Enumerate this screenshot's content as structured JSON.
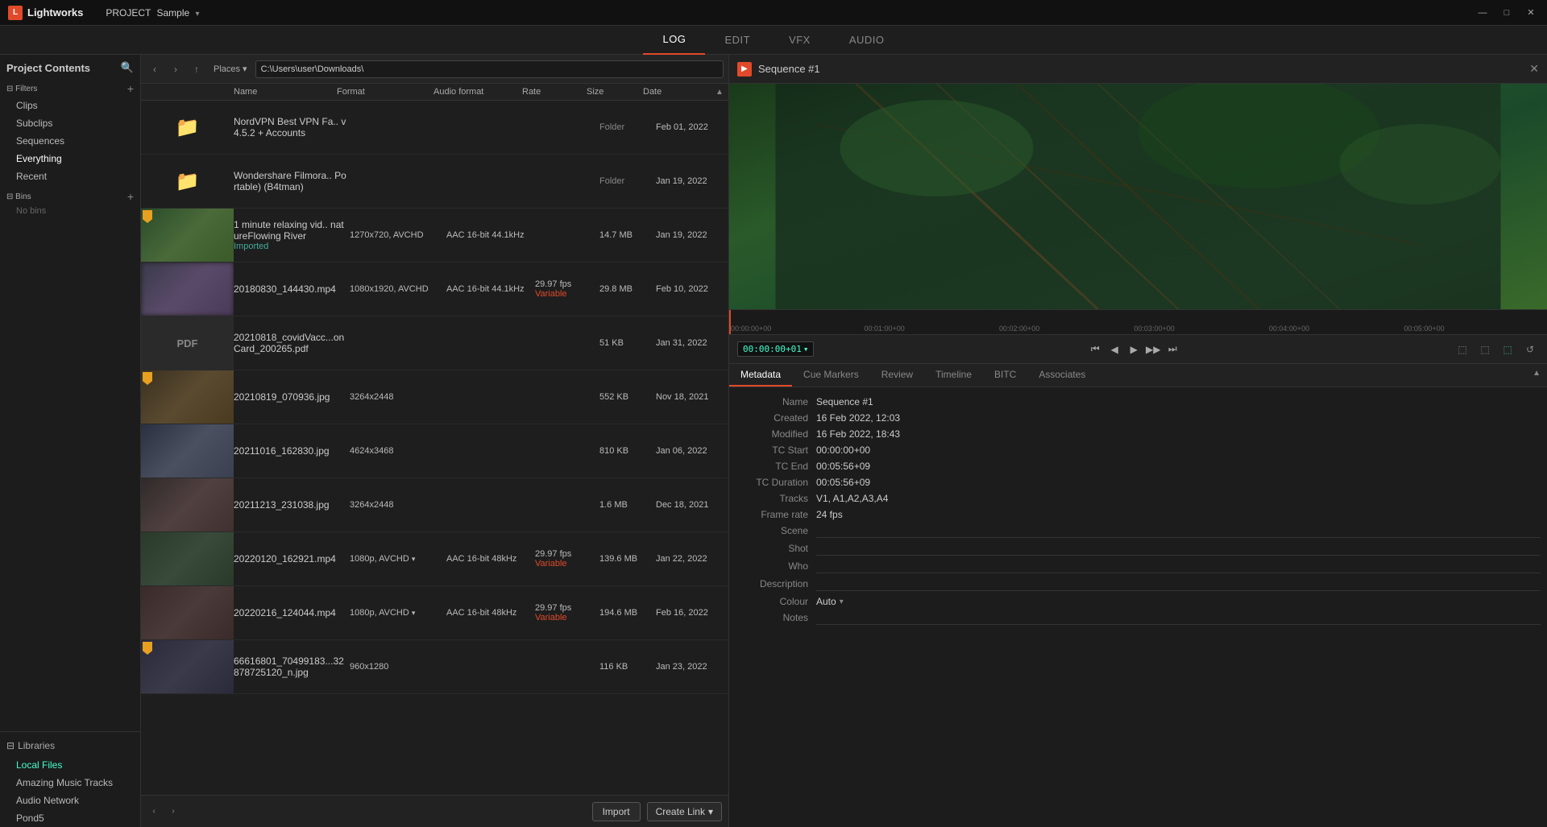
{
  "app": {
    "title": "Lightworks",
    "logo_letter": "L"
  },
  "titlebar": {
    "project_label": "PROJECT",
    "project_name": "Sample",
    "minimize": "—",
    "maximize": "□",
    "close": "✕"
  },
  "navtabs": {
    "tabs": [
      "LOG",
      "EDIT",
      "VFX",
      "AUDIO"
    ],
    "active": "LOG"
  },
  "sidebar": {
    "project_contents_label": "Project Contents",
    "filters_label": "Filters",
    "filter_items": [
      "Clips",
      "Subclips",
      "Sequences",
      "Everything",
      "Recent"
    ],
    "bins_label": "Bins",
    "no_bins": "No bins",
    "libraries_label": "Libraries",
    "library_items": [
      "Local Files",
      "Amazing Music Tracks",
      "Audio Network",
      "Pond5"
    ]
  },
  "filebrowser": {
    "toolbar": {
      "back": "‹",
      "forward": "›",
      "up": "↑",
      "places": "Places",
      "path": "C:\\Users\\user\\Downloads\\"
    },
    "columns": {
      "name": "Name",
      "format": "Format",
      "audio_format": "Audio format",
      "rate": "Rate",
      "size": "Size",
      "date": "Date"
    },
    "rows": [
      {
        "thumb_type": "folder",
        "name": "NordVPN Best VPN Fa.. v4.5.2 + Accounts",
        "format": "",
        "audio_format": "",
        "rate": "",
        "size": "Folder",
        "date": "Feb 01, 2022"
      },
      {
        "thumb_type": "folder",
        "name": "Wondershare Filmora.. Portable) (B4tman)",
        "format": "",
        "audio_format": "",
        "rate": "",
        "size": "Folder",
        "date": "Jan 19, 2022"
      },
      {
        "thumb_type": "video_green",
        "name": "1 minute relaxing vid.. natureFlowing River",
        "sub": "Imported",
        "format": "1270x720, AVCHD",
        "audio_format": "AAC 16-bit 44.1kHz",
        "rate": "",
        "size": "14.7 MB",
        "date": "Jan 19, 2022",
        "flag": true
      },
      {
        "thumb_type": "video_blurred",
        "name": "20180830_144430.mp4",
        "format": "1080x1920, AVCHD",
        "audio_format": "AAC 16-bit 44.1kHz",
        "rate": "29.97 fps",
        "rate_variable": true,
        "size": "29.8 MB",
        "date": "Feb 10, 2022"
      },
      {
        "thumb_type": "pdf",
        "name": "20210818_covidVacc...onCard_200265.pdf",
        "format": "",
        "audio_format": "",
        "rate": "",
        "size": "51 KB",
        "date": "Jan 31, 2022"
      },
      {
        "thumb_type": "image",
        "name": "20210819_070936.jpg",
        "format": "3264x2448",
        "audio_format": "",
        "rate": "",
        "size": "552 KB",
        "date": "Nov 18, 2021",
        "flag": true
      },
      {
        "thumb_type": "image2",
        "name": "20211016_162830.jpg",
        "format": "4624x3468",
        "audio_format": "",
        "rate": "",
        "size": "810 KB",
        "date": "Jan 06, 2022"
      },
      {
        "thumb_type": "image3",
        "name": "20211213_231038.jpg",
        "format": "3264x2448",
        "audio_format": "",
        "rate": "",
        "size": "1.6 MB",
        "date": "Dec 18, 2021"
      },
      {
        "thumb_type": "video_blurred2",
        "name": "20220120_162921.mp4",
        "format": "1080p, AVCHD ▾",
        "audio_format": "AAC 16-bit 48kHz",
        "rate": "29.97 fps",
        "rate_variable": true,
        "size": "139.6 MB",
        "date": "Jan 22, 2022"
      },
      {
        "thumb_type": "video_blurred3",
        "name": "20220216_124044.mp4",
        "format": "1080p, AVCHD ▾",
        "audio_format": "AAC 16-bit 48kHz",
        "rate": "29.97 fps",
        "rate_variable": true,
        "size": "194.6 MB",
        "date": "Feb 16, 2022"
      },
      {
        "thumb_type": "image4",
        "name": "66616801_70499183...32878725120_n.jpg",
        "format": "960x1280",
        "audio_format": "",
        "rate": "",
        "size": "116 KB",
        "date": "Jan 23, 2022",
        "flag": true
      }
    ],
    "bottom": {
      "import_btn": "Import",
      "createlink_btn": "Create Link",
      "createlink_arrow": "▾"
    }
  },
  "viewer": {
    "title": "Sequence #1",
    "timeline_markers": [
      "00:00:00+00",
      "00:01:00+00",
      "00:02:00+00",
      "00:03:00+00",
      "00:04:00+00",
      "00:05:00+00"
    ],
    "tc_display": "00:00:00+01",
    "tc_dropdown": "▾"
  },
  "metadata_tabs": [
    "Metadata",
    "Cue Markers",
    "Review",
    "Timeline",
    "BITC",
    "Associates"
  ],
  "metadata": {
    "active_tab": "Metadata",
    "fields": [
      {
        "label": "Name",
        "value": "Sequence #1"
      },
      {
        "label": "Created",
        "value": "16 Feb 2022, 12:03"
      },
      {
        "label": "Modified",
        "value": "16 Feb 2022, 18:43"
      },
      {
        "label": "TC Start",
        "value": "00:00:00+00"
      },
      {
        "label": "TC End",
        "value": "00:05:56+09"
      },
      {
        "label": "TC Duration",
        "value": "00:05:56+09"
      },
      {
        "label": "Tracks",
        "value": "V1, A1,A2,A3,A4"
      },
      {
        "label": "Frame rate",
        "value": "24 fps"
      },
      {
        "label": "Scene",
        "value": ""
      },
      {
        "label": "Shot",
        "value": ""
      },
      {
        "label": "Who",
        "value": ""
      },
      {
        "label": "Description",
        "value": ""
      },
      {
        "label": "Colour",
        "value": "Auto"
      },
      {
        "label": "Notes",
        "value": ""
      }
    ]
  },
  "icons": {
    "search": "🔍",
    "folder": "📁",
    "back": "‹",
    "forward": "›",
    "up": "↑",
    "chevron_down": "▾",
    "transport_start": "⏮",
    "transport_prev": "◀",
    "transport_play": "▶",
    "transport_next": "▶▶",
    "transport_end": "⏭",
    "collapse": "▲",
    "expand_up": "▴"
  }
}
